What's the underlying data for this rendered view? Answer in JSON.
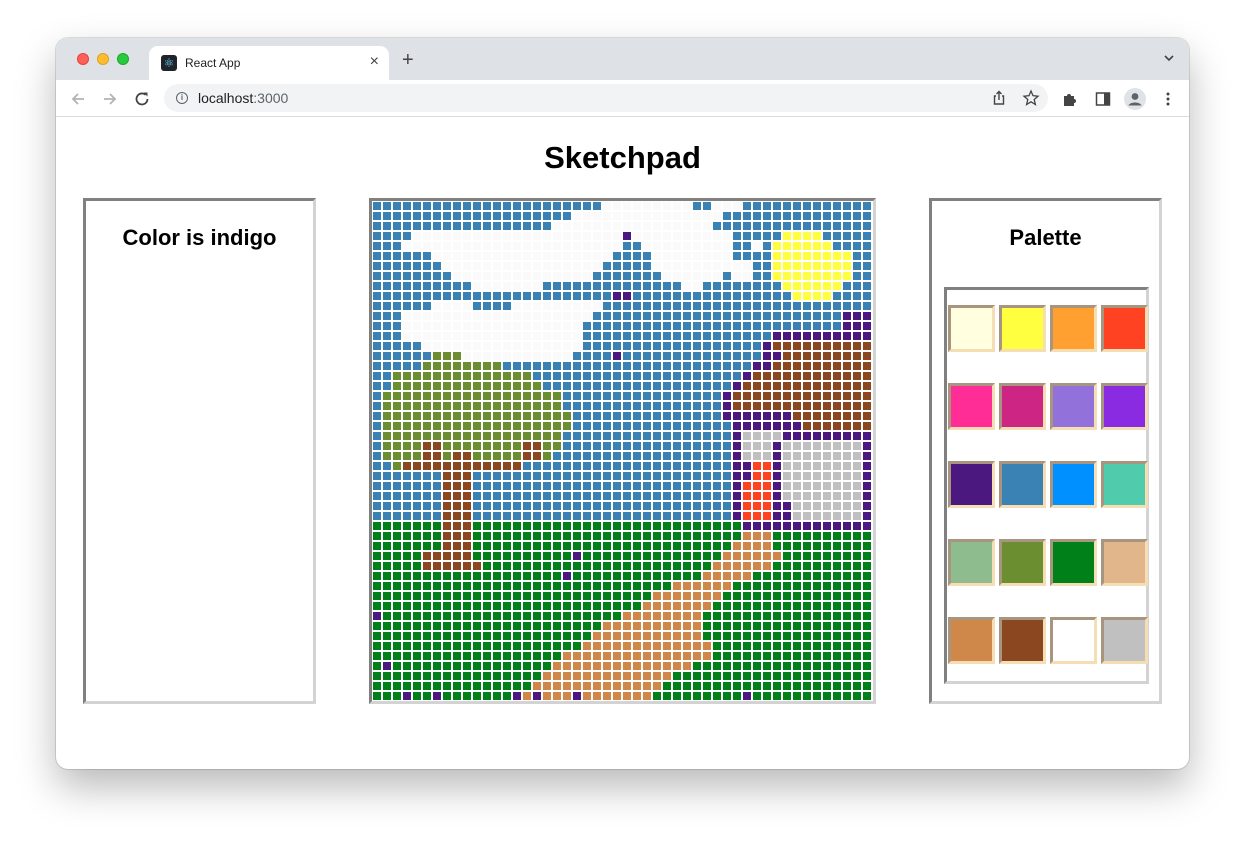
{
  "browser": {
    "tab_title": "React App",
    "url_host": "localhost",
    "url_port": ":3000"
  },
  "page": {
    "title": "Sketchpad",
    "color_status": "Color is indigo",
    "palette_heading": "Palette",
    "selected_color": "indigo"
  },
  "palette": [
    {
      "name": "lightyellow",
      "hex": "#ffffe0"
    },
    {
      "name": "yellow",
      "hex": "#ffff3f"
    },
    {
      "name": "orange",
      "hex": "#ffa030"
    },
    {
      "name": "orangered",
      "hex": "#ff4322"
    },
    {
      "name": "hotpink",
      "hex": "#ff2d95"
    },
    {
      "name": "mediumvioletred",
      "hex": "#cc2583"
    },
    {
      "name": "mediumpurple",
      "hex": "#9371db"
    },
    {
      "name": "blueviolet",
      "hex": "#8a2be2"
    },
    {
      "name": "indigo",
      "hex": "#4b1880"
    },
    {
      "name": "steelblue",
      "hex": "#3b82b4"
    },
    {
      "name": "dodgerblue",
      "hex": "#0090ff"
    },
    {
      "name": "mediumaquamarine",
      "hex": "#50cbab"
    },
    {
      "name": "darkseagreen",
      "hex": "#8fbc8f"
    },
    {
      "name": "olivedrab",
      "hex": "#6b8e30"
    },
    {
      "name": "green",
      "hex": "#008018"
    },
    {
      "name": "burlywood",
      "hex": "#e0b68a"
    },
    {
      "name": "peru",
      "hex": "#d0874a"
    },
    {
      "name": "saddlebrown",
      "hex": "#8b4820"
    },
    {
      "name": "white",
      "hex": "#ffffff"
    },
    {
      "name": "silver",
      "hex": "#c0c0c0"
    }
  ],
  "canvas": {
    "columns": 50,
    "rows": 50,
    "legend": {
      "S": "#3b82b4",
      "W": "#fafafa",
      "Y": "#ffff3f",
      "I": "#4b1880",
      "B": "#8b4820",
      "O": "#6b8e30",
      "C": "#c0c0c0",
      "R": "#ff4322",
      "G": "#008018",
      "P": "#d0874a"
    },
    "pixels": [
      "SSSSSSSSSSSSSSSSSSSSSSSWWWWWWWWWSSWWWSSSSSSSSSSSSS",
      "SSSSSSSSSSSSSSSSSSSSWWWWWWWWWWWWWWWSSSSSSSSSSSSSSS",
      "SSSSSSSSSSSSSSSSSSWWWWWWWWWWWWWWWWSSSSSSSSSSSSSSSS",
      "SSSSWWWWWWWWWWWWWWWWWWWWWIWWWWWWWWWWSSSSSYYYYSSSSS",
      "SSSWWWWWWWWWWWWWWWWWWWWWWSSWWWWWWWWWSSWSYYYYYYSSSS",
      "SSSSSSWWWWWWWWWWWWWWWWWWSSSSWWWWWWWWSSSSYYYYYYYYSS",
      "SSSSSSSWWWWWWWWWWWWWWWWSSSSSWWWWWWWWWWSSYYYYYYYYSS",
      "SSSSSSSSWWWWWWWWWWWWWWSSSSSSSWWWWWWSWWSSYYYYYYYYSS",
      "SSSSSSSSSSWWWWWWWSSSSSSSSSSSSSSWWSSSSSSSSYYYYYYSSS",
      "SSSSSSSSSSSSSSSSSSSSSSSSIISSSSSSSSSSSSSSSSYYYYSSSS",
      "SSSSSSWWWWSSSSWWWWWWWWWSSSSSSSSSSSSSSSSSSSSSSSSSSS",
      "SSSWWWWWWWWWWWWWWWWWWWSSSSSSSSSSSSSSSSSSSSSSSSSIII",
      "SSSWWWWWWWWWWWWWWWWWWSSSSSSSSSSSSSSSSSSSSSSSSSSIII",
      "SSSWWWWWWWWWWWWWWWWWWSSSSSSSSSSSSSSSSSSSIIIIIIIIII",
      "SSSSSWWWWWWWWWWWWWWWWSSSSSSSSSSSSSSSSSSIBBBBBBBBBB",
      "SSSSSSOOOWWWWWWWWWWWSSSSISSSSSSSSSSSSSSIIBBBBBBBBB",
      "SSSSSOOOOOOOOSSSSSSSSSSSSSSSSSSSSSSSSSIIBBBBBBBBBB",
      "SSOOOOOOOOOOOOOOSSSSSSSSSSSSSSSSSSSSSIBBBBBBBBBBBB",
      "SSOOOOOOOOOOOOOOOSSSSSSSSSSSSSSSSSSSIBBBBBBBBBBBBB",
      "SOOOOOOOOOOOOOOOOOOSSSSSSSSSSSSSSSSIBBBBBBBBBBBBBB",
      "SOOOOOOOOOOOOOOOOOOSSSSSSSSSSSSSSSSIBBBBBBBBBBBBBB",
      "SOOOOOOOOOOOOOOOOOOOSSSSSSSSSSSSSSSIIIIIIIBBBBBBBB",
      "SOOOOOOOOOOOOOOOOOOOSSSSSSSSSSSSSSSSIIIIIIIBBBBBBB",
      "SOOOOOOOOOOOOOOOOOOSSSSSSSSSSSSSSSSSICCCCIIIIIIIII",
      "SOOOOBBOOOOOOOOBBOOSSSSSSSSSSSSSSSSSICCCICCCCCCCCI",
      "SOOOOBBOBBOOOOOBBOSSSSSSSSSSSSSSSSSSICCCICCCCCCCCI",
      "SSOBBBBBBBBBBBBSSSSSSSSSSSSSSSSSSSSSIIRRICCCCCCCCI",
      "SSSSSSSBBBSSSSSSSSSSSSSSSSSSSSSSSSSSIIRRICCCCCCCCI",
      "SSSSSSSBBBSSSSSSSSSSSSSSSSSSSSSSSSSSIRRRICCCCCCCCI",
      "SSSSSSSBBBSSSSSSSSSSSSSSSSSSSSSSSSSSIRRRICCCCCCCCI",
      "SSSSSSSBBBSSSSSSSSSSSSSSSSSSSSSSSSSSIRRRIICCCCCCCI",
      "SSSSSSSBBBSSSSSSSSSSSSSSSSSSSSSSSSSSIRRRIICCCCCCCI",
      "GGGGGGGBBBGGGGGGGGGGGGGGGGGGGGGGGGGGGIIIIIIIIIIIII",
      "GGGGGGGBBBGGGGGGGGGGGGGGGGGGGGGGGGGGGPPPGGGGGGGGGG",
      "GGGGGGGBBBGGGGGGGGGGGGGGGGGGGGGGGGGGPPPPGGGGGGGGGG",
      "GGGGGBBBBBGGGGGGGGGGIGGGGGGGGGGGGGGPPPPPPGGGGGGGGG",
      "GGGGGBBBBBBGGGGGGGGGGGGGGGGGGGGGGGPPPPPPGGGGGGGGGG",
      "GGGGGGGGGGGGGGGGGGGIGGGGGGGGGGGGGPPPPPGGGGGGGGGGGG",
      "GGGGGGGGGGGGGGGGGGGGGGGGGGGGGGPPPPPPGGGGGGGGGGGGGG",
      "GGGGGGGGGGGGGGGGGGGGGGGGGGGGPPPPPPPGGGGGGGGGGGGGGG",
      "GGGGGGGGGGGGGGGGGGGGGGGGGGGPPPPPPPGGGGGGGGGGGGGGGG",
      "IGGGGGGGGGGGGGGGGGGGGGGGGPPPPPPPPGGGGGGGGGGGGGGGGG",
      "GGGGGGGGGGGGGGGGGGGGGGGPPPPPPPPPPGGGGGGGGGGGGGGGGG",
      "GGGGGGGGGGGGGGGGGGGGGGPPPPPPPPPPPGGGGGGGGGGGGGGGGG",
      "GGGGGGGGGGGGGGGGGGGGGPPPPPPPPPPPPPGGGGGGGGGGGGGGGG",
      "GGGGGGGGGGGGGGGGGGGPPPPPPPPPPPPPPPGGGGGGGGGGGGGGGG",
      "GIGGGGGGGGGGGGGGGGPPPPPPPPPPPPPPGGGGGGGGGGGGGGGGGG",
      "GGGGGGGGGGGGGGGGGPPPPPPPPPPPPPGGGGGGGGGGGGGGGGGGGG",
      "GGGGGGGGGGGGGGGGPPPPPPPPPPPPPGGGGGGGGGGGGGGGGGGGGG",
      "GGGIGGIGGGGGGGIPIPPPIPPPPPPPGGGGGGGGGIGGGGGGGGGGGG"
    ]
  }
}
